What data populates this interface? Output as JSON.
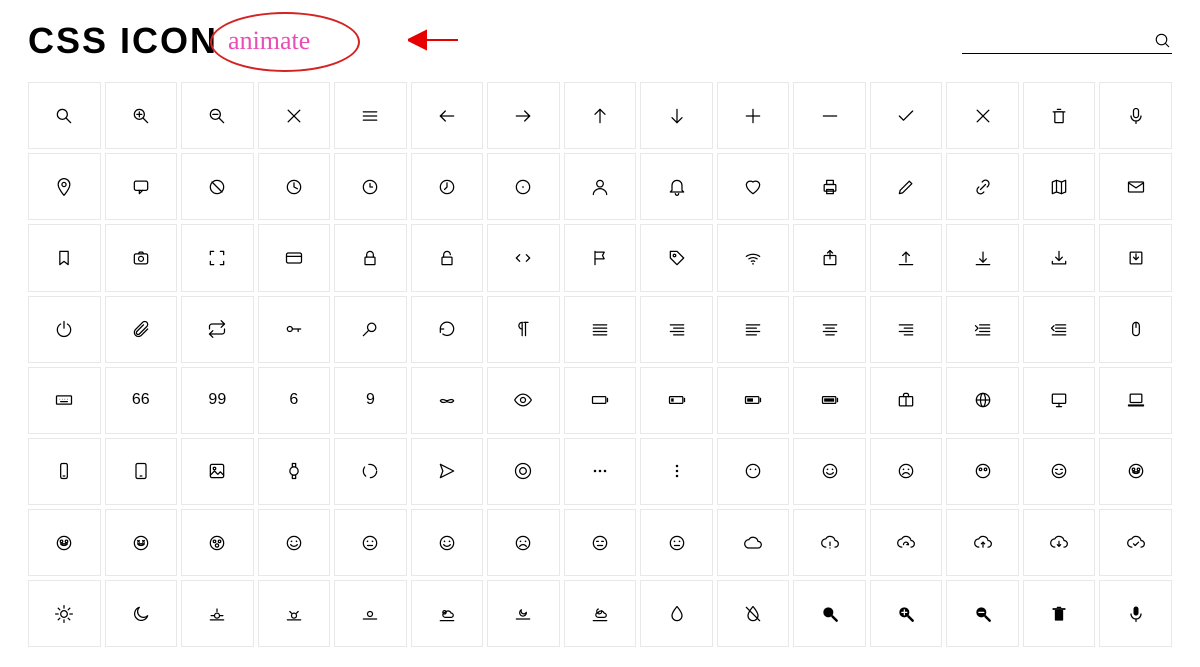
{
  "header": {
    "title": "CSS ICON",
    "animate_label": "animate",
    "search_placeholder": ""
  },
  "icons": [
    [
      "search",
      "zoom-in",
      "zoom-out",
      "close",
      "menu",
      "arrow-left",
      "arrow-right",
      "arrow-up",
      "arrow-down",
      "plus",
      "minus",
      "check",
      "times",
      "trash",
      "mic"
    ],
    [
      "location",
      "comment",
      "ban",
      "clock",
      "time",
      "time-alt",
      "clock-dot",
      "user",
      "bell",
      "heart",
      "printer",
      "edit",
      "link",
      "map",
      "mail"
    ],
    [
      "bookmark",
      "camera",
      "expand",
      "credit-card",
      "lock",
      "unlock",
      "code",
      "flag",
      "tag",
      "wifi",
      "share",
      "upload",
      "download",
      "download-alt",
      "download-box"
    ],
    [
      "power",
      "attachment",
      "repeat",
      "key",
      "search-alt",
      "undo",
      "paragraph",
      "align-justify",
      "align-right",
      "align-left",
      "align-center",
      "align-right-2",
      "indent",
      "outdent",
      "mouse"
    ],
    [
      "keyboard",
      "quote-left",
      "quote-right",
      "six",
      "nine",
      "mustache",
      "eye",
      "battery-empty",
      "battery-low",
      "battery-mid",
      "battery-full",
      "briefcase",
      "globe",
      "desktop",
      "laptop"
    ],
    [
      "mobile",
      "tablet",
      "image",
      "watch",
      "loading",
      "send",
      "help",
      "more-h",
      "more-v",
      "face-1",
      "face-2",
      "face-3",
      "face-4",
      "face-5",
      "face-6"
    ],
    [
      "face-7",
      "face-8",
      "face-9",
      "face-10",
      "face-11",
      "face-12",
      "face-13",
      "face-14",
      "face-15",
      "cloud",
      "cloud-alert",
      "cloud-sync",
      "cloud-up",
      "cloud-down",
      "cloud-check"
    ],
    [
      "sun",
      "moon",
      "sunrise",
      "sunset",
      "day",
      "day-cloud",
      "night",
      "night-cloud",
      "drop",
      "drop-off",
      "search-fill",
      "zoom-in-fill",
      "zoom-out-fill",
      "trash-fill",
      "mic-fill"
    ]
  ]
}
